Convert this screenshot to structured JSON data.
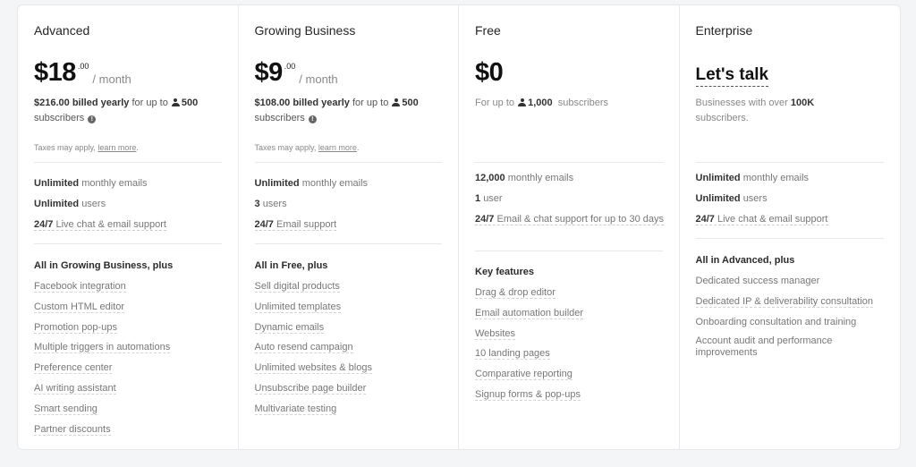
{
  "plans": [
    {
      "name": "Advanced",
      "price": "$18",
      "cents": ".00",
      "period": "/ month",
      "billing_amount": "$216.00 billed yearly",
      "billing_for": "for up to",
      "subscribers_count": "500",
      "subscribers_label": "subscribers",
      "taxes_text": "Taxes may apply,",
      "taxes_link": "learn more",
      "taxes_end": ".",
      "limits": [
        {
          "bold": "Unlimited",
          "text": "monthly emails"
        },
        {
          "bold": "Unlimited",
          "text": "users"
        },
        {
          "bold": "24/7",
          "text": "Live chat & email support"
        }
      ],
      "features_heading": "All in Growing Business, plus",
      "features": [
        "Facebook integration",
        "Custom HTML editor",
        "Promotion pop-ups",
        "Multiple triggers in automations",
        "Preference center",
        "AI writing assistant",
        "Smart sending",
        "Partner discounts"
      ]
    },
    {
      "name": "Growing Business",
      "price": "$9",
      "cents": ".00",
      "period": "/ month",
      "billing_amount": "$108.00 billed yearly",
      "billing_for": "for up to",
      "subscribers_count": "500",
      "subscribers_label": "subscribers",
      "taxes_text": "Taxes may apply,",
      "taxes_link": "learn more",
      "taxes_end": ".",
      "limits": [
        {
          "bold": "Unlimited",
          "text": "monthly emails"
        },
        {
          "bold": "3",
          "text": "users"
        },
        {
          "bold": "24/7",
          "text": "Email support"
        }
      ],
      "features_heading": "All in Free, plus",
      "features": [
        "Sell digital products",
        "Unlimited templates",
        "Dynamic emails",
        "Auto resend campaign",
        "Unlimited websites & blogs",
        "Unsubscribe page builder",
        "Multivariate testing"
      ]
    },
    {
      "name": "Free",
      "price": "$0",
      "billing_prefix": "For up to",
      "subscribers_count": "1,000",
      "subscribers_label": "subscribers",
      "limits": [
        {
          "bold": "12,000",
          "text": "monthly emails"
        },
        {
          "bold": "1",
          "text": "user"
        },
        {
          "bold": "24/7",
          "text": "Email & chat support for up to 30 days"
        }
      ],
      "features_heading": "Key features",
      "features": [
        "Drag & drop editor",
        "Email automation builder",
        "Websites",
        "10 landing pages",
        "Comparative reporting",
        "Signup forms & pop-ups"
      ]
    },
    {
      "name": "Enterprise",
      "price": "Let's talk",
      "description_prefix": "Businesses with over",
      "description_bold": "100K",
      "description_suffix": "subscribers.",
      "limits": [
        {
          "bold": "Unlimited",
          "text": "monthly emails"
        },
        {
          "bold": "Unlimited",
          "text": "users"
        },
        {
          "bold": "24/7",
          "text": "Live chat & email support"
        }
      ],
      "features_heading": "All in Advanced, plus",
      "features": [
        "Dedicated success manager",
        "Dedicated IP & deliverability consultation",
        "Onboarding consultation and training",
        "Account audit and performance improvements"
      ]
    }
  ]
}
